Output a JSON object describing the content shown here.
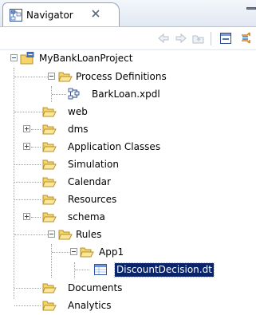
{
  "view": {
    "tab_title": "Navigator",
    "tab_icon": "navigator-icon",
    "close_icon": "close-icon"
  },
  "toolbar": {
    "buttons": [
      {
        "name": "back-icon"
      },
      {
        "name": "forward-icon"
      },
      {
        "name": "up-folder-icon"
      },
      {
        "name": "collapse-all-icon"
      },
      {
        "name": "link-with-editor-icon"
      }
    ]
  },
  "tree": {
    "project": "MyBankLoanProject",
    "process_definitions": "Process Definitions",
    "process_file": "BarkLoan.xpdl",
    "web": "web",
    "dms": "dms",
    "application_classes": "Application Classes",
    "simulation": "Simulation",
    "calendar": "Calendar",
    "resources": "Resources",
    "schema": "schema",
    "rules": "Rules",
    "app1": "App1",
    "decision_table": "DiscountDecision.dt",
    "documents": "Documents",
    "analytics": "Analytics"
  },
  "colors": {
    "selection": "#0a246a",
    "folder": "#f5d46a",
    "folder_border": "#b8922a"
  }
}
